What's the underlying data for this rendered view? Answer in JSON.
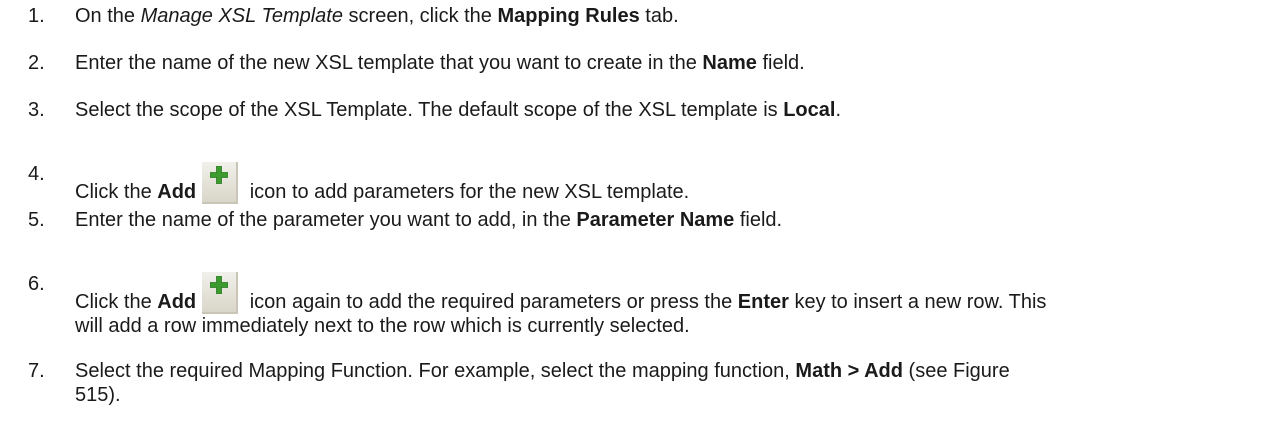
{
  "steps": [
    {
      "number": "1.",
      "parts": [
        "On the ",
        "Manage XSL Template",
        " screen, click the ",
        "Mapping Rules",
        " tab."
      ]
    },
    {
      "number": "2.",
      "parts": [
        "Enter the name of the new XSL template that you want to create in the ",
        "Name",
        " field."
      ]
    },
    {
      "number": "3.",
      "parts": [
        "Select the scope of the XSL Template. The default scope of the XSL template is ",
        "Local",
        "."
      ]
    },
    {
      "number": "4.",
      "parts": [
        "Click the ",
        "Add",
        " icon to add parameters for the new XSL template."
      ]
    },
    {
      "number": "5.",
      "parts": [
        "Enter the name of the parameter you want to add, in the ",
        "Parameter Name",
        " field."
      ]
    },
    {
      "number": "6.",
      "parts": [
        "Click the ",
        "Add",
        " icon again to add the required parameters or press the ",
        "Enter",
        " key to insert a new row. This",
        "will add a row immediately next to the row which is currently selected."
      ]
    },
    {
      "number": "7.",
      "parts": [
        "Select the required Mapping Function. For example, select the mapping function, ",
        "Math > Add",
        " (see Figure",
        "515)."
      ]
    }
  ],
  "icons": {
    "add_icon": "green-plus-add-icon",
    "add_icon_color": "#3c9a2e"
  }
}
